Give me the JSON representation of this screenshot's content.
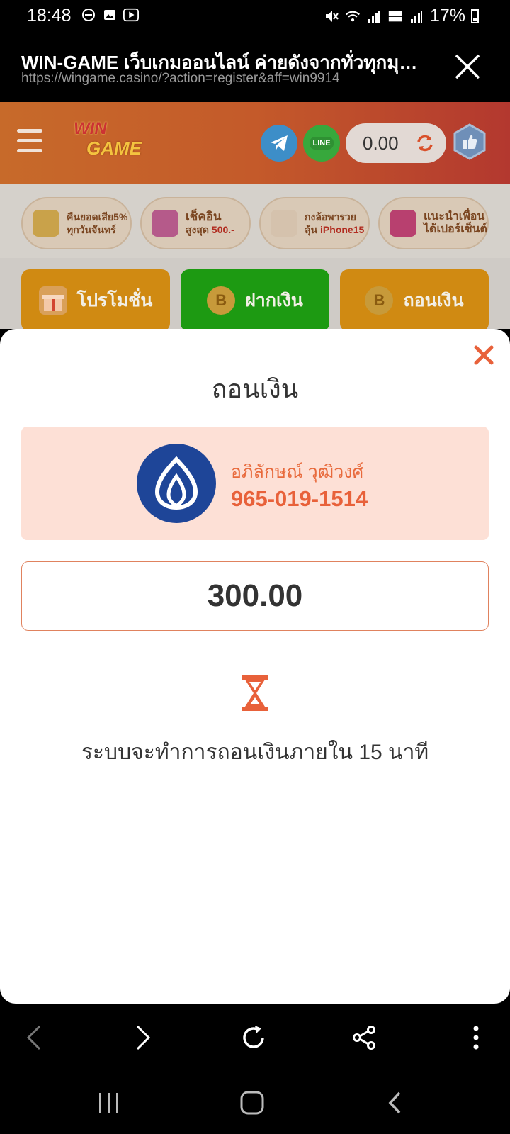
{
  "status_bar": {
    "time": "18:48",
    "battery": "17%",
    "icons": [
      "do-not-disturb-icon",
      "gallery-icon",
      "media-icon",
      "mute-icon",
      "wifi-icon",
      "signal-icon",
      "volte-icon",
      "signal-icon",
      "battery-icon"
    ]
  },
  "browser": {
    "title": "WIN-GAME เว็บเกมออนไลน์ ค่ายดังจากทั่วทุกมุมโลก",
    "url": "https://wingame.casino/?action=register&aff=win9914"
  },
  "site": {
    "logo_line1": "WIN",
    "logo_line2": "GAME",
    "line_label": "LINE",
    "balance": "0.00",
    "promos": [
      {
        "line1": "คืนยอดเสีย5%",
        "line2": "ทุกวันจันทร์"
      },
      {
        "line1": "เช็คอิน",
        "line2_a": "สูงสุด ",
        "line2_b": "500.-"
      },
      {
        "line1": "กงล้อพารวย",
        "line2_a": "ลุ้น ",
        "line2_b": "iPhone15"
      },
      {
        "line1": "แนะนำเพื่อน",
        "line2": "ได้เปอร์เซ็นต์"
      }
    ],
    "buttons": {
      "promotion": "โปรโมชั่น",
      "deposit": "ฝากเงิน",
      "withdraw": "ถอนเงิน",
      "coin": "B"
    }
  },
  "modal": {
    "title": "ถอนเงิน",
    "account_name": "อภิลักษณ์ วุฒิวงศ์",
    "account_number": "965-019-1514",
    "amount": "300.00",
    "notice": "ระบบจะทำการถอนเงินภายใน 15 นาที"
  },
  "colors": {
    "accent": "#e8613a",
    "bank_card_bg": "#fde0d6",
    "bank_logo": "#1e4598",
    "header_orange": "#c76a2a",
    "header_red": "#b3382f"
  }
}
